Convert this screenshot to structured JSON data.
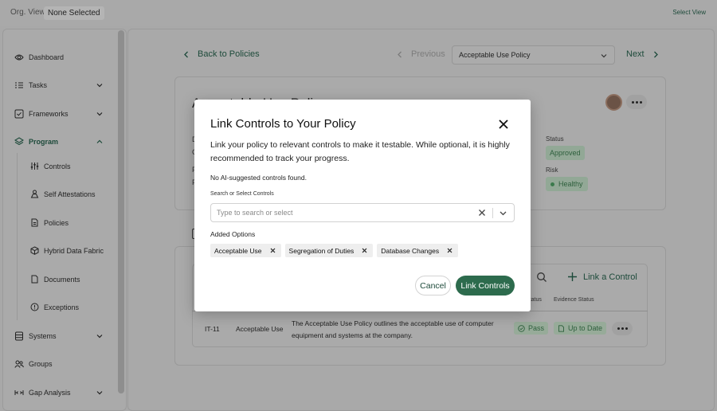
{
  "topbar": {
    "org_view": "Org. View",
    "org_selection": "None Selected",
    "select_view": "Select View"
  },
  "sidebar": {
    "items": [
      {
        "label": "Dashboard",
        "icon": "eye-icon"
      },
      {
        "label": "Tasks",
        "icon": "list-icon"
      },
      {
        "label": "Frameworks",
        "icon": "check-square-icon"
      },
      {
        "label": "Program",
        "icon": "layers-icon",
        "active": true
      },
      {
        "label": "Systems",
        "icon": "database-icon"
      },
      {
        "label": "Groups",
        "icon": "users-icon"
      },
      {
        "label": "Gap Analysis",
        "icon": "gap-icon"
      }
    ],
    "program_children": [
      {
        "label": "Controls",
        "icon": "sliders-icon"
      },
      {
        "label": "Self Attestations",
        "icon": "person-icon"
      },
      {
        "label": "Policies",
        "icon": "file-icon"
      },
      {
        "label": "Hybrid Data Fabric",
        "icon": "cube-icon"
      },
      {
        "label": "Documents",
        "icon": "document-icon"
      },
      {
        "label": "Exceptions",
        "icon": "alert-circle-icon"
      }
    ]
  },
  "nav": {
    "back": "Back to Policies",
    "previous": "Previous",
    "policy_select": "Acceptable Use Policy",
    "next": "Next"
  },
  "policy": {
    "title_fragment": "Acceptable Use Policy",
    "left_fragments": [
      "D",
      "C",
      "P",
      "P"
    ],
    "status_label": "Status",
    "status_value": "Approved",
    "risk_label": "Risk",
    "risk_value": "Healthy"
  },
  "controls_table": {
    "link_control": "Link a Control",
    "headers": {
      "status": "Status",
      "evidence_status": "Evidence Status"
    },
    "rows": [
      {
        "id": "IT-11",
        "name": "Acceptable Use",
        "description_line1": "The Acceptable Use Policy outlines the acceptable use of computer",
        "description_line2": "equipment and systems at the company.",
        "status": "Pass",
        "evidence": "Up to Date"
      }
    ]
  },
  "modal": {
    "title": "Link Controls to Your Policy",
    "description": "Link your policy to relevant controls to make it testable. While optional, it is highly recommended to track your progress.",
    "no_suggestions": "No AI-suggested controls found.",
    "search_label": "Search or Select Controls",
    "search_placeholder": "Type to search or select",
    "search_value": "",
    "added_label": "Added Options",
    "chips": [
      "Acceptable Use",
      "Segregation of Duties",
      "Database Changes"
    ],
    "cancel": "Cancel",
    "submit": "Link Controls",
    "accent_color": "#2d6b4d"
  }
}
